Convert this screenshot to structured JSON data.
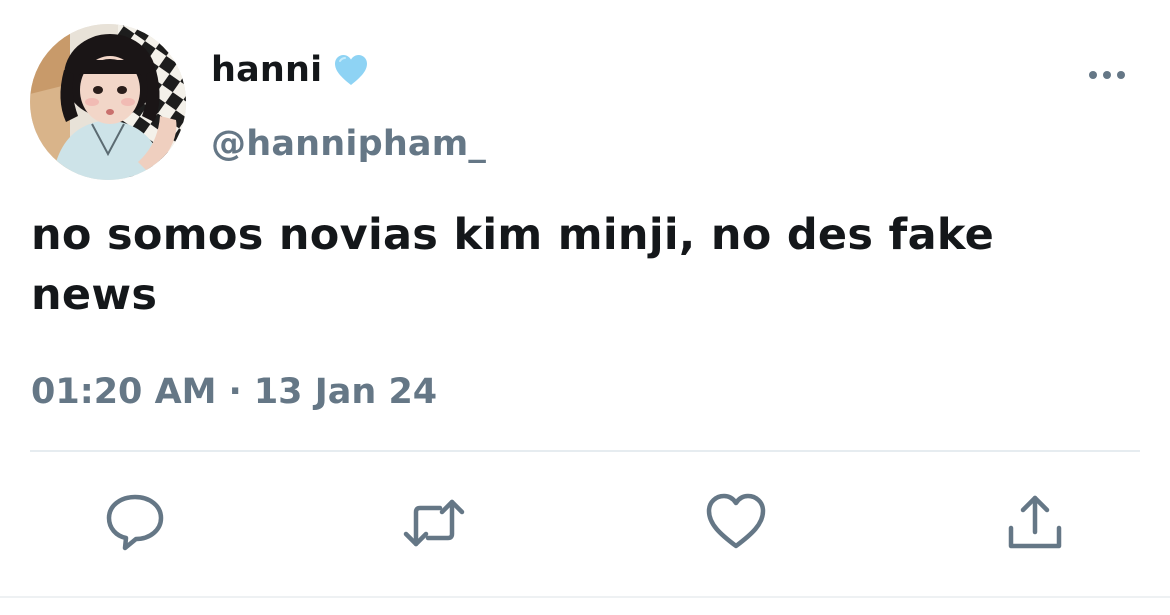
{
  "author": {
    "display_name": "hanni",
    "handle": "@hannipham_",
    "badge_icon": "light-blue-heart-icon",
    "avatar_icon": "profile-photo"
  },
  "tweet": {
    "text": "no somos novias kim minji, no des fake news",
    "time": "01:20 AM",
    "separator": "·",
    "date": "13 Jan 24"
  },
  "actions": {
    "icons": [
      "reply-icon",
      "retweet-icon",
      "like-icon",
      "share-icon"
    ]
  },
  "colors": {
    "text": "#14171a",
    "secondary": "#657786",
    "icon": "#657786",
    "heart_badge": "#8ed3f4",
    "divider": "#e6ecf0"
  }
}
